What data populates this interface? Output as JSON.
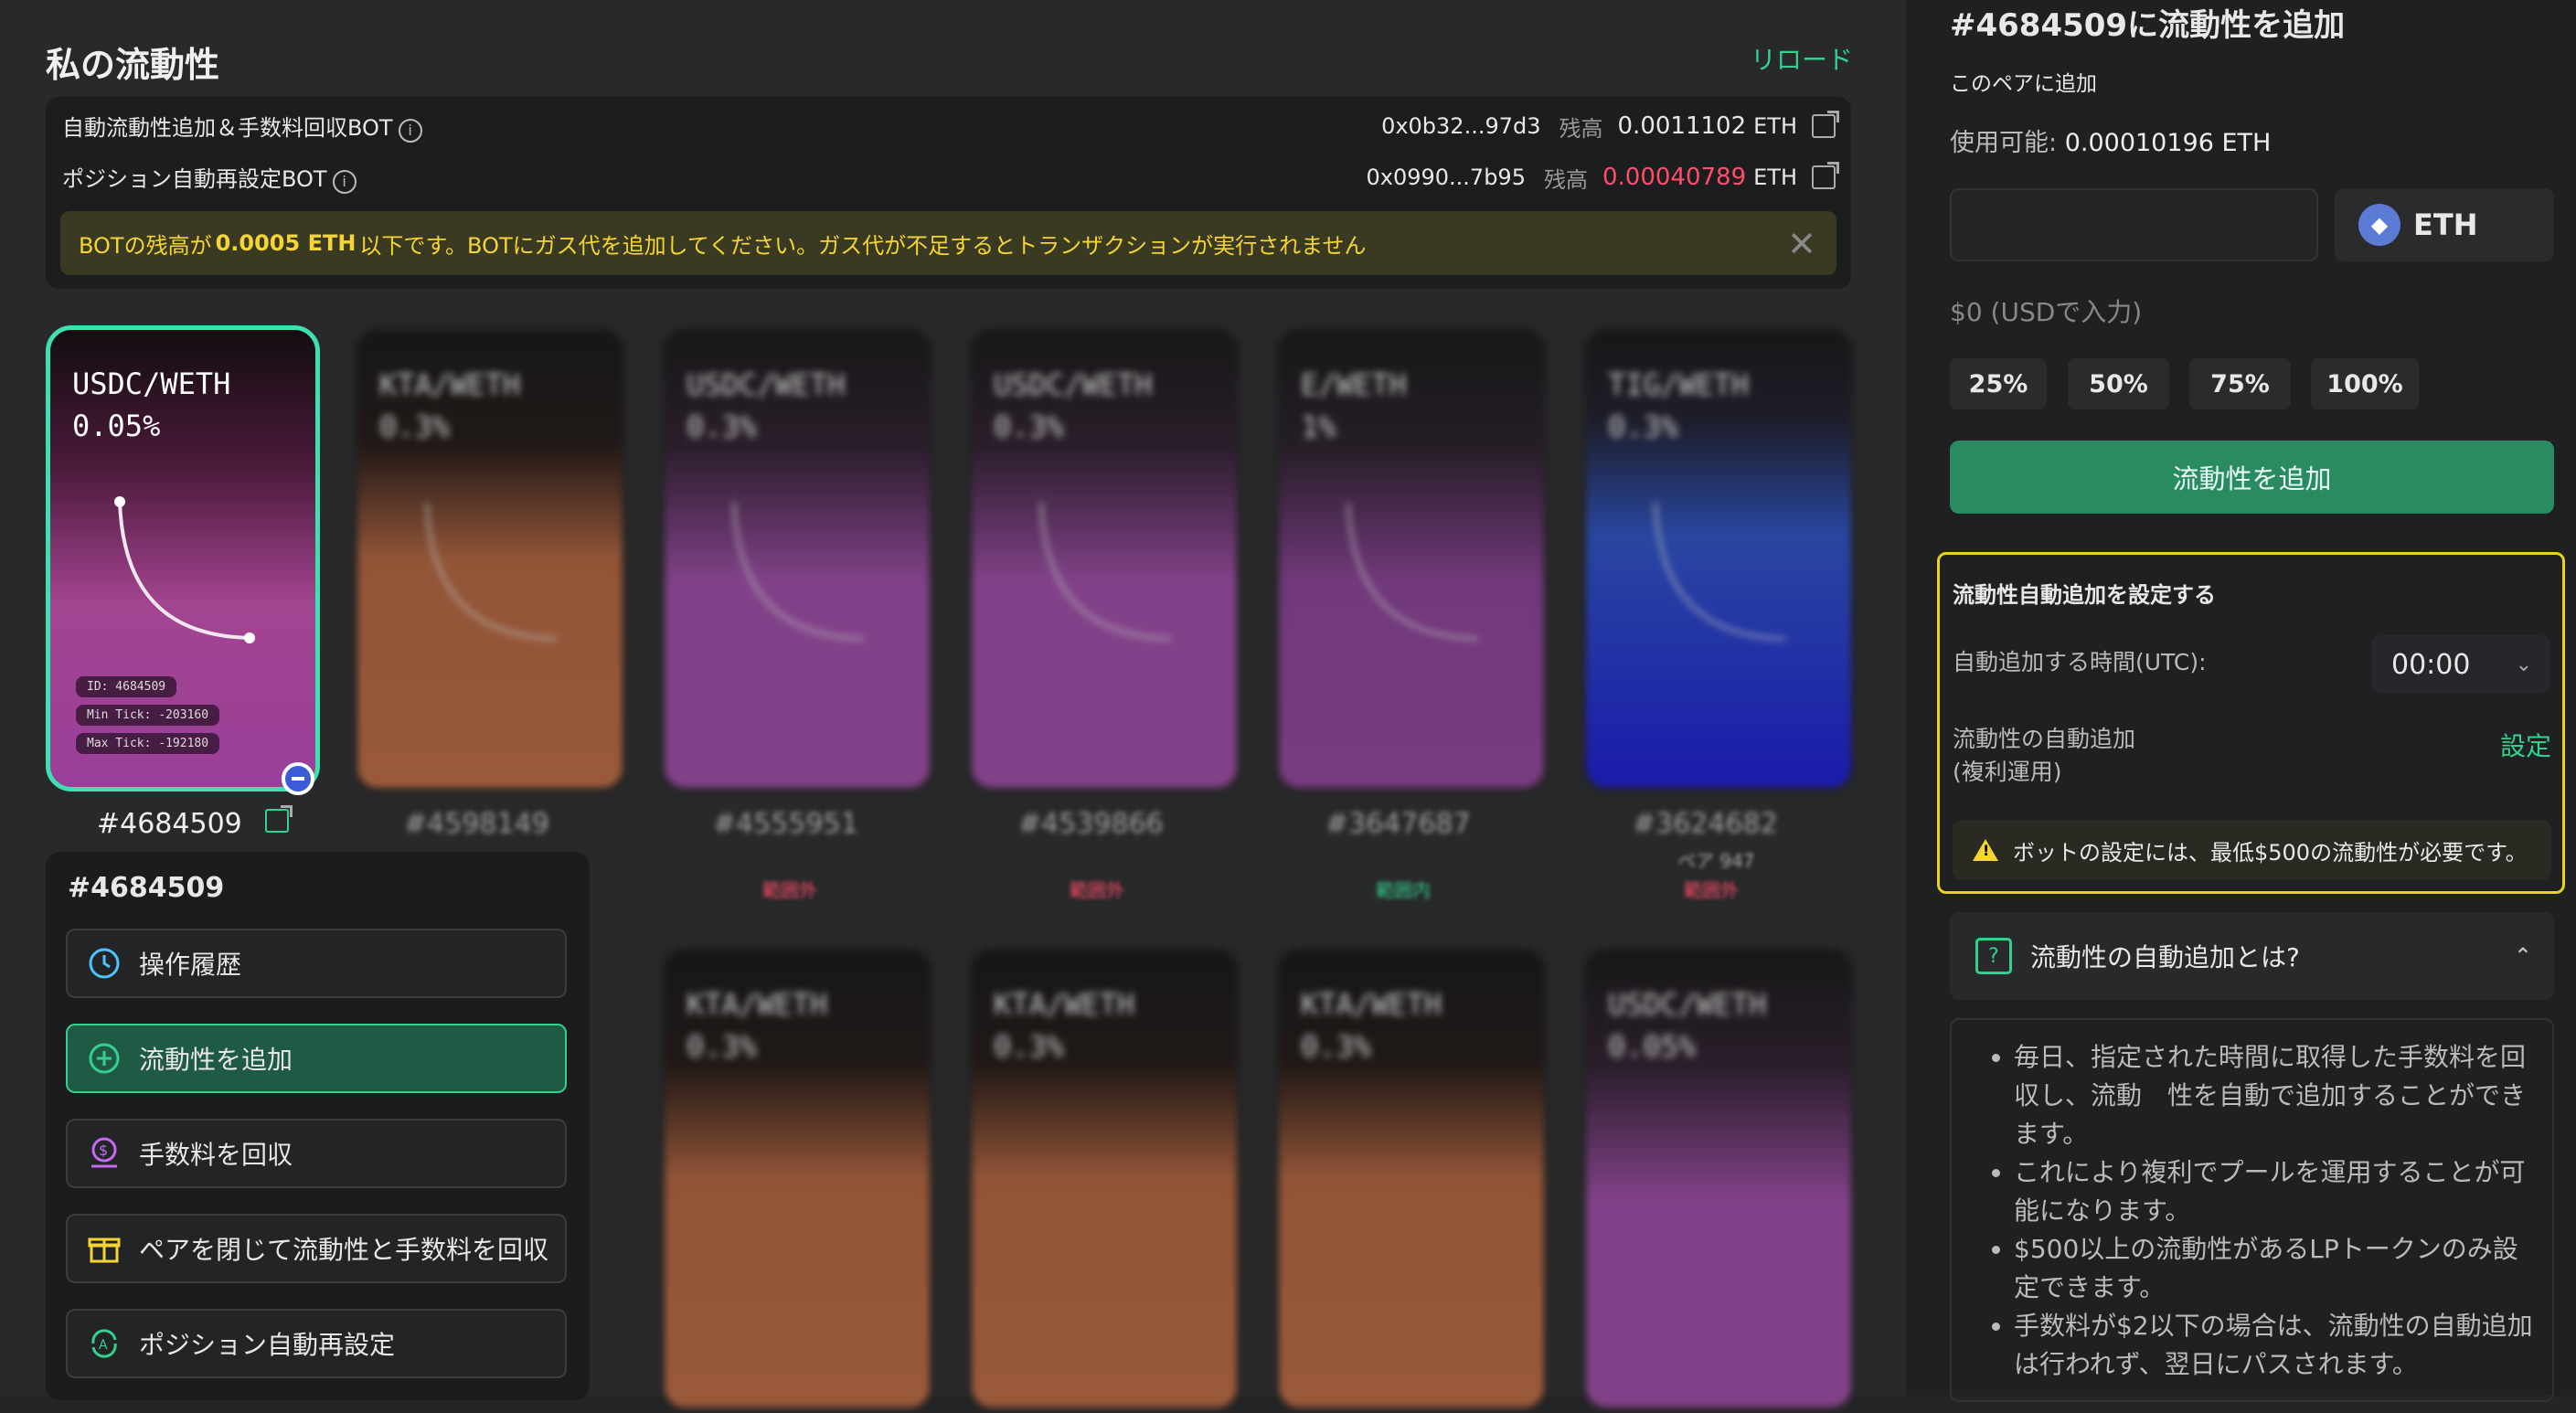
{
  "page": {
    "title": "私の流動性",
    "reload": "リロード"
  },
  "bots": [
    {
      "label": "自動流動性追加＆手数料回収BOT",
      "address": "0x0b32...97d3",
      "balance_label": "残高",
      "balance": "0.0011102",
      "unit": "ETH",
      "low": false
    },
    {
      "label": "ポジション自動再設定BOT",
      "address": "0x0990...7b95",
      "balance_label": "残高",
      "balance": "0.00040789",
      "unit": "ETH",
      "low": true
    }
  ],
  "warning": {
    "pre": "BOTの残高が",
    "amount": "0.0005 ETH",
    "post": "以下です。BOTにガス代を追加してください。ガス代が不足するとトランザクションが実行されません"
  },
  "positions": [
    {
      "id": "#4684509",
      "pair": "USDC/WETH",
      "fee": "0.05%",
      "tag_id": "ID: 4684509",
      "tag_min": "Min Tick: -203160",
      "tag_max": "Max Tick: -192180",
      "gradient": "pink",
      "status": ""
    },
    {
      "id": "#4598149",
      "pair": "KTA/WETH",
      "fee": "0.3%",
      "gradient": "orange",
      "status": ""
    },
    {
      "id": "#4555951",
      "pair": "USDC/WETH",
      "fee": "0.3%",
      "gradient": "purple",
      "status": "範囲外"
    },
    {
      "id": "#4539866",
      "pair": "USDC/WETH",
      "fee": "0.3%",
      "gradient": "purple",
      "status": "範囲外"
    },
    {
      "id": "#3647687",
      "pair": "E/WETH",
      "fee": "1%",
      "gradient": "violet",
      "status": "範囲内"
    },
    {
      "id": "#3624682",
      "pair": "TIG/WETH",
      "fee": "0.3%",
      "gradient": "blue",
      "status": "範囲外",
      "extra": "ペア 947"
    }
  ],
  "positions_row2": [
    {
      "pair": "KTA/WETH",
      "fee": "0.3%"
    },
    {
      "pair": "KTA/WETH",
      "fee": "0.3%"
    },
    {
      "pair": "KTA/WETH",
      "fee": "0.3%"
    },
    {
      "pair": "USDC/WETH",
      "fee": "0.05%"
    }
  ],
  "menu": {
    "title": "#4684509",
    "items": [
      "操作履歴",
      "流動性を追加",
      "手数料を回収",
      "ペアを閉じて流動性と手数料を回収",
      "ポジション自動再設定"
    ]
  },
  "panel": {
    "title": "#4684509に流動性を追加",
    "subtitle": "このペアに追加",
    "avail_label": "使用可能:",
    "avail_value": "0.00010196 ETH",
    "token": "ETH",
    "usd": "$0 (USDで入力)",
    "percents": [
      "25%",
      "50%",
      "75%",
      "100%"
    ],
    "add_button": "流動性を追加",
    "auto": {
      "title": "流動性自動追加を設定する",
      "time_label": "自動追加する時間(UTC):",
      "time_value": "00:00",
      "compound_label_1": "流動性の自動追加",
      "compound_label_2": "(複利運用)",
      "set": "設定",
      "warning": "ボットの設定には、最低$500の流動性が必要です。"
    },
    "faq": {
      "title": "流動性の自動追加とは?",
      "items": [
        "毎日、指定された時間に取得した手数料を回収し、流動　性を自動で追加することができます。",
        "これにより複利でプールを運用することが可能になります。",
        "$500以上の流動性があるLPトークンのみ設定できます。",
        "手数料が$2以下の場合は、流動性の自動追加は行われず、翌日にパスされます。"
      ]
    }
  },
  "colors": {
    "accent": "#35d08d",
    "warn": "#f4d535",
    "danger": "#ff4d6a"
  }
}
